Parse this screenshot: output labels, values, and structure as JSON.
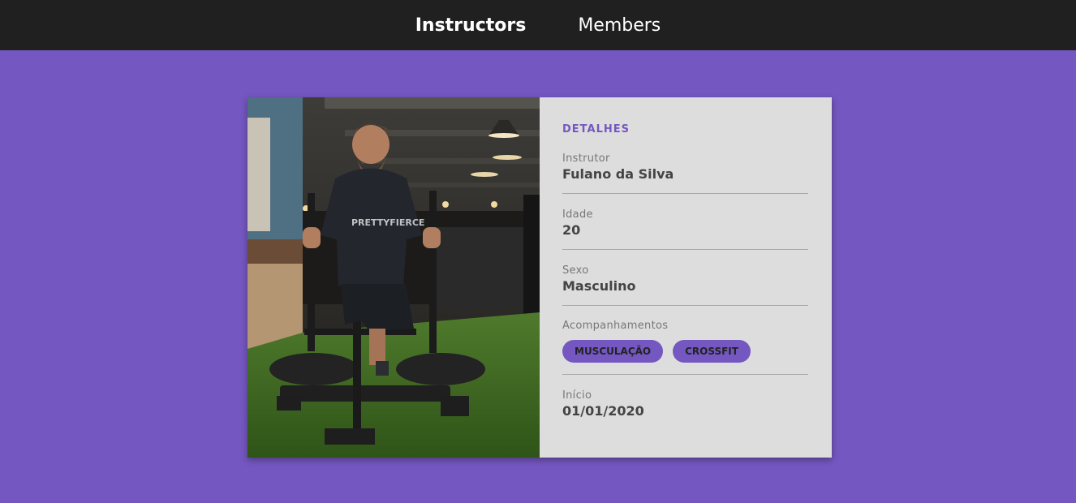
{
  "nav": {
    "instructors": "Instructors",
    "members": "Members"
  },
  "card": {
    "section_title": "DETALHES",
    "photo_icon": "instructor-photo",
    "shirt_text": "PRETTYFIERCE",
    "fields": {
      "instructor": {
        "label": "Instrutor",
        "value": "Fulano da Silva"
      },
      "age": {
        "label": "Idade",
        "value": "20"
      },
      "sex": {
        "label": "Sexo",
        "value": "Masculino"
      },
      "services": {
        "label": "Acompanhamentos",
        "tags": [
          "MUSCULAÇÃO",
          "CROSSFIT"
        ]
      },
      "start": {
        "label": "Início",
        "value": "01/01/2020"
      }
    }
  },
  "colors": {
    "background": "#7457c1",
    "topbar": "#202020",
    "accent": "#7457c1",
    "card_bg": "#dddddd"
  }
}
